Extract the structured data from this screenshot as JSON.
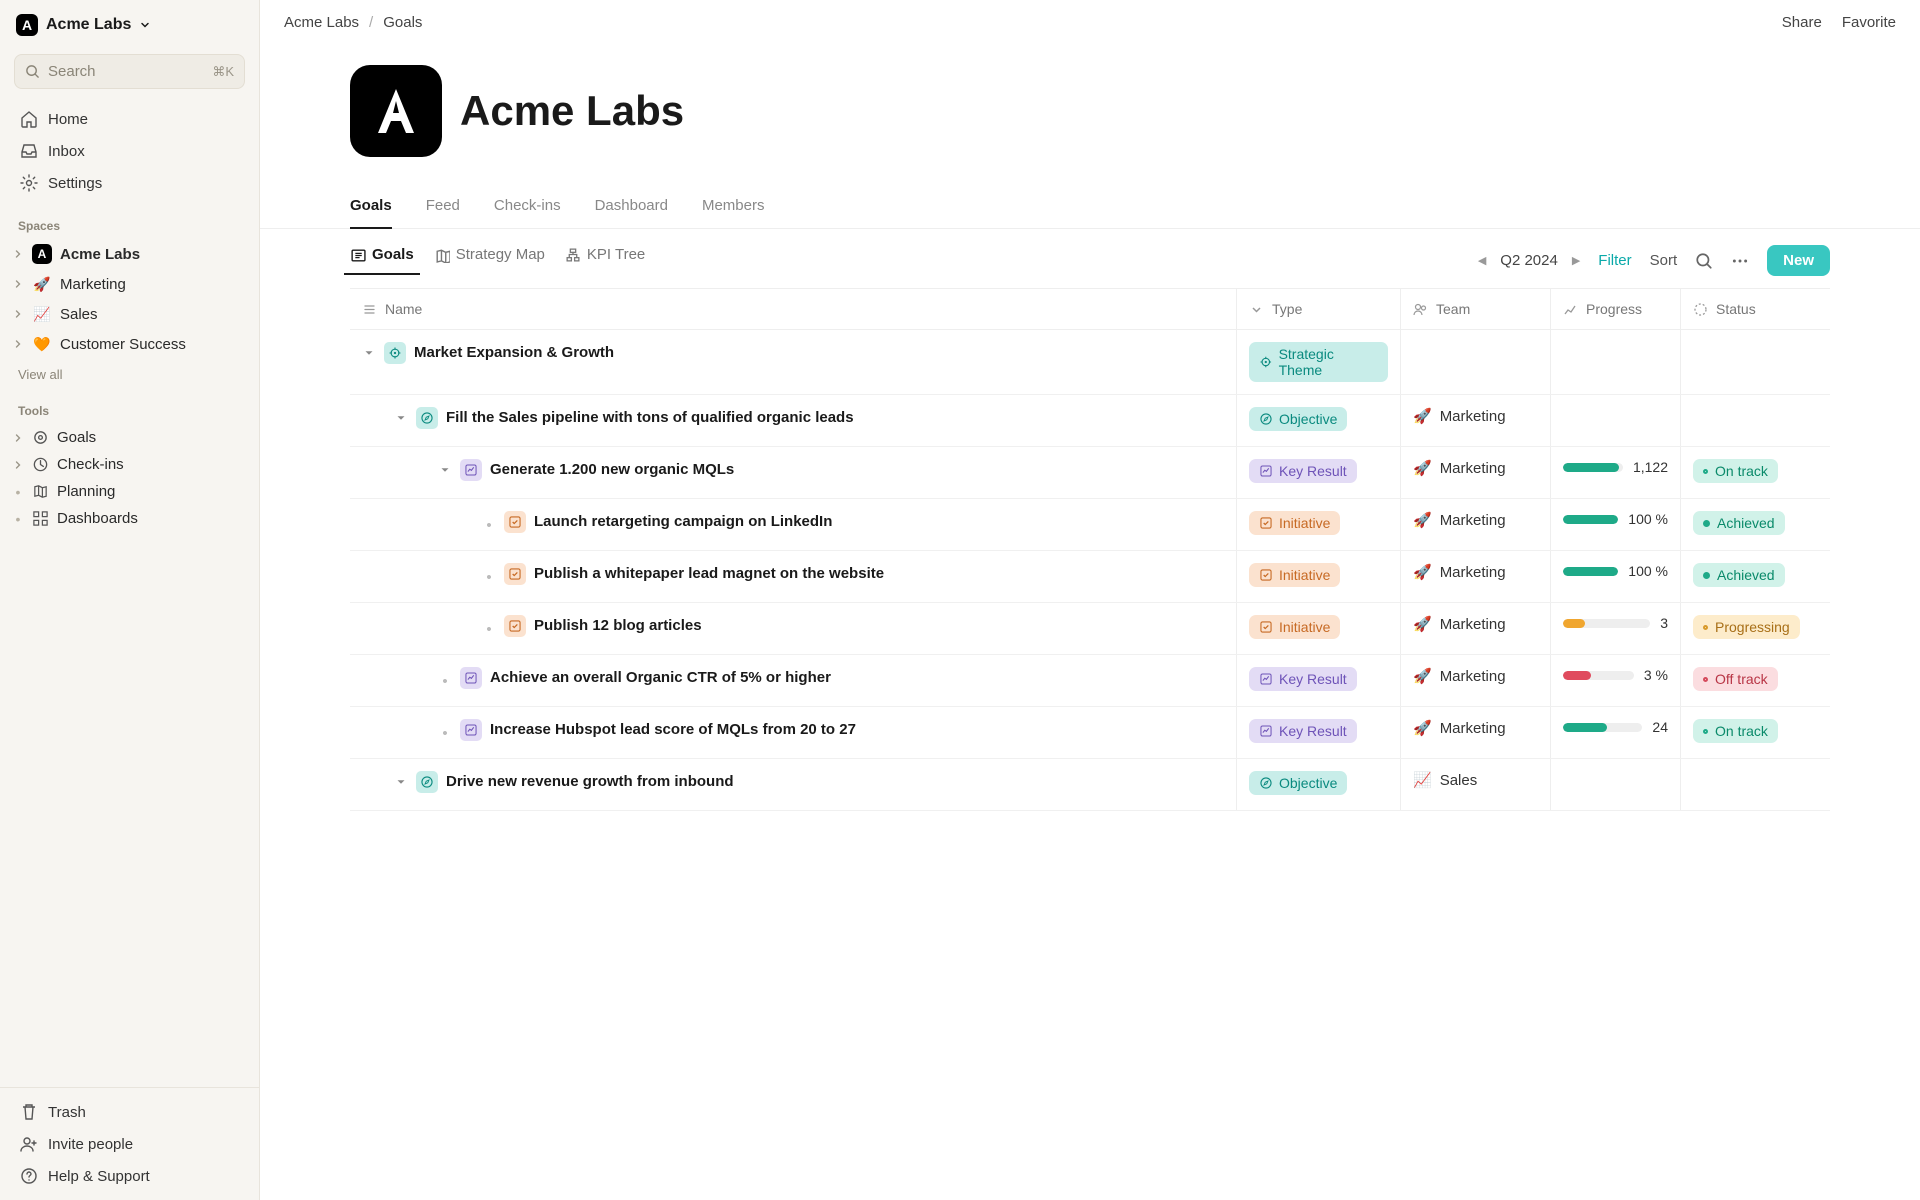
{
  "workspace": {
    "name": "Acme Labs"
  },
  "search": {
    "placeholder": "Search",
    "shortcut": "⌘K"
  },
  "nav": {
    "home": "Home",
    "inbox": "Inbox",
    "settings": "Settings"
  },
  "sections": {
    "spaces_label": "Spaces",
    "tools_label": "Tools",
    "view_all": "View all"
  },
  "spaces": [
    {
      "label": "Acme Labs",
      "emoji": "A",
      "dark": true,
      "bold": true
    },
    {
      "label": "Marketing",
      "emoji": "🚀"
    },
    {
      "label": "Sales",
      "emoji": "📈"
    },
    {
      "label": "Customer Success",
      "emoji": "🧡"
    }
  ],
  "tools": [
    {
      "label": "Goals",
      "icon": "target",
      "expandable": true
    },
    {
      "label": "Check-ins",
      "icon": "clock",
      "expandable": true
    },
    {
      "label": "Planning",
      "icon": "map",
      "expandable": false
    },
    {
      "label": "Dashboards",
      "icon": "grid",
      "expandable": false
    }
  ],
  "footer_nav": {
    "trash": "Trash",
    "invite": "Invite people",
    "help": "Help & Support"
  },
  "breadcrumb": {
    "root": "Acme Labs",
    "current": "Goals"
  },
  "topbar": {
    "share": "Share",
    "favorite": "Favorite"
  },
  "page": {
    "title": "Acme Labs"
  },
  "tabs": [
    {
      "label": "Goals",
      "active": true
    },
    {
      "label": "Feed"
    },
    {
      "label": "Check-ins"
    },
    {
      "label": "Dashboard"
    },
    {
      "label": "Members"
    }
  ],
  "view_tabs": [
    {
      "label": "Goals",
      "icon": "list",
      "active": true
    },
    {
      "label": "Strategy Map",
      "icon": "map"
    },
    {
      "label": "KPI Tree",
      "icon": "tree"
    }
  ],
  "toolbar": {
    "period": "Q2 2024",
    "filter": "Filter",
    "sort": "Sort",
    "new": "New"
  },
  "columns": {
    "name": "Name",
    "type": "Type",
    "team": "Team",
    "progress": "Progress",
    "status": "Status"
  },
  "teams": {
    "marketing": {
      "label": "Marketing",
      "emoji": "🚀"
    },
    "sales": {
      "label": "Sales",
      "emoji": "📈"
    }
  },
  "type_labels": {
    "theme": "Strategic Theme",
    "objective": "Objective",
    "kr": "Key Result",
    "initiative": "Initiative"
  },
  "status_labels": {
    "on_track": "On track",
    "achieved": "Achieved",
    "progressing": "Progressing",
    "off_track": "Off track"
  },
  "rows": [
    {
      "name": "Market Expansion & Growth",
      "type": "theme",
      "indent": 0,
      "caret": "down"
    },
    {
      "name": "Fill the Sales pipeline with tons of qualified organic leads",
      "type": "objective",
      "indent": 1,
      "caret": "down",
      "team": "marketing"
    },
    {
      "name": "Generate 1.200 new organic MQLs",
      "type": "kr",
      "indent": 2,
      "caret": "down",
      "team": "marketing",
      "progress": {
        "pct": 94,
        "label": "1,122",
        "color": "green"
      },
      "status": "on_track"
    },
    {
      "name": "Launch retargeting campaign on LinkedIn",
      "type": "initiative",
      "indent": 3,
      "caret": "dot",
      "team": "marketing",
      "progress": {
        "pct": 100,
        "label": "100 %",
        "color": "green"
      },
      "status": "achieved"
    },
    {
      "name": "Publish a whitepaper lead magnet on the website",
      "type": "initiative",
      "indent": 3,
      "caret": "dot",
      "team": "marketing",
      "progress": {
        "pct": 100,
        "label": "100 %",
        "color": "green"
      },
      "status": "achieved"
    },
    {
      "name": "Publish 12 blog articles",
      "type": "initiative",
      "indent": 3,
      "caret": "dot",
      "team": "marketing",
      "progress": {
        "pct": 25,
        "label": "3",
        "color": "amber"
      },
      "status": "progressing"
    },
    {
      "name": "Achieve an overall Organic CTR of 5% or higher",
      "type": "kr",
      "indent": 2,
      "caret": "dot",
      "team": "marketing",
      "progress": {
        "pct": 40,
        "label": "3 %",
        "color": "red"
      },
      "status": "off_track"
    },
    {
      "name": "Increase Hubspot lead score of MQLs from 20 to 27",
      "type": "kr",
      "indent": 2,
      "caret": "dot",
      "team": "marketing",
      "progress": {
        "pct": 55,
        "label": "24",
        "color": "green"
      },
      "status": "on_track"
    },
    {
      "name": "Drive new revenue growth from inbound",
      "type": "objective",
      "indent": 1,
      "caret": "down",
      "team": "sales"
    }
  ]
}
